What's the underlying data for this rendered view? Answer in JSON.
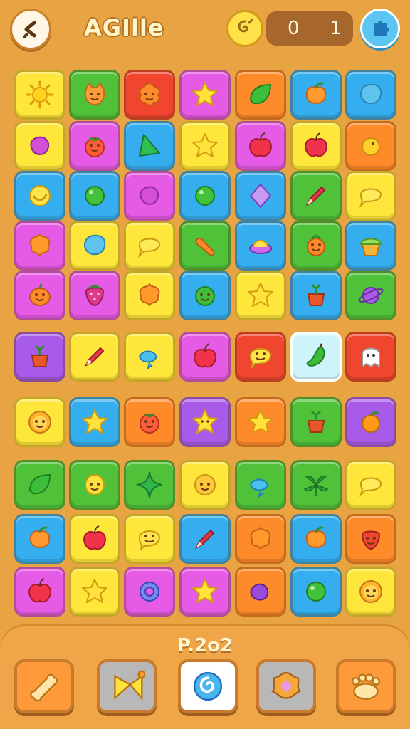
{
  "header": {
    "title": "AGIlle",
    "score_left": "0",
    "score_right": "1"
  },
  "footer": {
    "level_label": "P.2o2"
  },
  "colors": {
    "yellow": "#FFE63A",
    "green": "#4FC23A",
    "red": "#F0452E",
    "magenta": "#E55BE6",
    "orange": "#FF8A2A",
    "blue": "#35AEEF",
    "purple": "#A75BE8",
    "pale_blue": "#CFF3FA"
  },
  "rows": [
    [
      {
        "c": "yellow",
        "icon": "sun-icon"
      },
      {
        "c": "green",
        "icon": "cat-face-icon"
      },
      {
        "c": "red",
        "icon": "flower-face-icon"
      },
      {
        "c": "magenta",
        "icon": "star-icon"
      },
      {
        "c": "orange",
        "icon": "leaf-icon"
      },
      {
        "c": "blue",
        "icon": "peach-icon"
      },
      {
        "c": "blue",
        "icon": "blob-icon"
      }
    ],
    [
      {
        "c": "yellow",
        "icon": "bean-icon"
      },
      {
        "c": "magenta",
        "icon": "tomato-face-icon"
      },
      {
        "c": "blue",
        "icon": "triangle-icon"
      },
      {
        "c": "yellow",
        "icon": "star-icon"
      },
      {
        "c": "magenta",
        "icon": "apple-icon"
      },
      {
        "c": "yellow",
        "icon": "apple-icon"
      },
      {
        "c": "orange",
        "icon": "chick-icon"
      }
    ],
    [
      {
        "c": "blue",
        "icon": "banana-icon"
      },
      {
        "c": "blue",
        "icon": "ball-icon"
      },
      {
        "c": "magenta",
        "icon": "bean-icon"
      },
      {
        "c": "blue",
        "icon": "ball-icon"
      },
      {
        "c": "blue",
        "icon": "diamond-icon"
      },
      {
        "c": "green",
        "icon": "crayon-icon"
      },
      {
        "c": "yellow",
        "icon": "speech-bubble-icon"
      }
    ],
    [
      {
        "c": "magenta",
        "icon": "flower-icon"
      },
      {
        "c": "yellow",
        "icon": "blob-icon"
      },
      {
        "c": "yellow",
        "icon": "speech-bubble-icon"
      },
      {
        "c": "green",
        "icon": "sausage-icon"
      },
      {
        "c": "blue",
        "icon": "saucer-icon"
      },
      {
        "c": "green",
        "icon": "carrot-face-icon"
      },
      {
        "c": "blue",
        "icon": "cupcake-icon"
      }
    ],
    [
      {
        "c": "magenta",
        "icon": "pumpkin-face-icon"
      },
      {
        "c": "magenta",
        "icon": "strawberry-icon"
      },
      {
        "c": "yellow",
        "icon": "flower-icon"
      },
      {
        "c": "blue",
        "icon": "frog-face-icon"
      },
      {
        "c": "yellow",
        "icon": "star-icon"
      },
      {
        "c": "blue",
        "icon": "flowerpot-icon"
      },
      {
        "c": "green",
        "icon": "planet-icon"
      }
    ],
    [
      {
        "c": "purple",
        "icon": "flowerpot-icon"
      },
      {
        "c": "yellow",
        "icon": "crayon-icon"
      },
      {
        "c": "yellow",
        "icon": "fish-icon"
      },
      {
        "c": "magenta",
        "icon": "apple-icon"
      },
      {
        "c": "red",
        "icon": "smiley-bubble-icon"
      },
      {
        "c": "pale_blue",
        "icon": "pepper-icon"
      },
      {
        "c": "red",
        "icon": "ghost-icon"
      }
    ],
    [
      {
        "c": "yellow",
        "icon": "lion-face-icon"
      },
      {
        "c": "blue",
        "icon": "star-icon"
      },
      {
        "c": "orange",
        "icon": "tomato-face-icon"
      },
      {
        "c": "purple",
        "icon": "star-face-icon"
      },
      {
        "c": "orange",
        "icon": "star-icon"
      },
      {
        "c": "green",
        "icon": "flowerpot-icon"
      },
      {
        "c": "purple",
        "icon": "orange-icon"
      }
    ],
    [
      {
        "c": "green",
        "icon": "leaf-icon"
      },
      {
        "c": "green",
        "icon": "lemon-face-icon"
      },
      {
        "c": "green",
        "icon": "sparkle-icon"
      },
      {
        "c": "yellow",
        "icon": "smiley-icon"
      },
      {
        "c": "green",
        "icon": "fish-icon"
      },
      {
        "c": "green",
        "icon": "palm-leaf-icon"
      },
      {
        "c": "yellow",
        "icon": "speech-bubble-icon"
      }
    ],
    [
      {
        "c": "blue",
        "icon": "peach-icon"
      },
      {
        "c": "yellow",
        "icon": "apple-icon"
      },
      {
        "c": "yellow",
        "icon": "smiley-bubble-icon"
      },
      {
        "c": "blue",
        "icon": "crayon-icon"
      },
      {
        "c": "orange",
        "icon": "flower-icon"
      },
      {
        "c": "blue",
        "icon": "peach-icon"
      },
      {
        "c": "orange",
        "icon": "strawberry-face-icon"
      }
    ],
    [
      {
        "c": "magenta",
        "icon": "apple-icon"
      },
      {
        "c": "yellow",
        "icon": "star-icon"
      },
      {
        "c": "magenta",
        "icon": "ring-icon"
      },
      {
        "c": "magenta",
        "icon": "star-icon"
      },
      {
        "c": "orange",
        "icon": "eggplant-icon"
      },
      {
        "c": "blue",
        "icon": "ball-icon"
      },
      {
        "c": "yellow",
        "icon": "lion-face-icon"
      }
    ]
  ],
  "tools": [
    {
      "icon": "bone-icon"
    },
    {
      "icon": "bow-icon"
    },
    {
      "icon": "swirl-icon"
    },
    {
      "icon": "cookie-icon"
    },
    {
      "icon": "paw-icon"
    }
  ]
}
